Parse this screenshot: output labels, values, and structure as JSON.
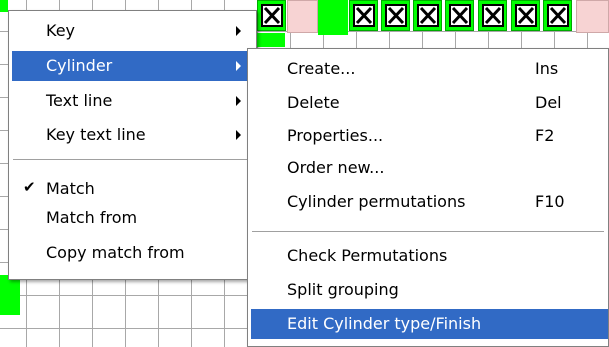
{
  "colors": {
    "grid_line": "#a8a8a8",
    "cell_green": "#00ff00",
    "cell_pink": "#f7d3d3",
    "menu_highlight": "#316ac5"
  },
  "context_menu": {
    "items": [
      {
        "label": "Key",
        "has_submenu": true
      },
      {
        "label": "Cylinder",
        "has_submenu": true,
        "selected": true
      },
      {
        "label": "Text line",
        "has_submenu": true
      },
      {
        "label": "Key text line",
        "has_submenu": true
      },
      {
        "label": "Match",
        "checked": true,
        "check_icon": "checkmark-icon"
      },
      {
        "label": "Match from"
      },
      {
        "label": "Copy match from"
      }
    ]
  },
  "cylinder_submenu": {
    "items": [
      {
        "label": "Create...",
        "shortcut": "Ins"
      },
      {
        "label": "Delete",
        "shortcut": "Del"
      },
      {
        "label": "Properties...",
        "shortcut": "F2"
      },
      {
        "label": "Order new...",
        "shortcut": ""
      },
      {
        "label": "Cylinder permutations",
        "shortcut": "F10"
      },
      {
        "label": "Check Permutations",
        "shortcut": ""
      },
      {
        "label": "Split grouping",
        "shortcut": ""
      },
      {
        "label": "Edit Cylinder type/Finish",
        "shortcut": "",
        "selected": true
      }
    ]
  }
}
